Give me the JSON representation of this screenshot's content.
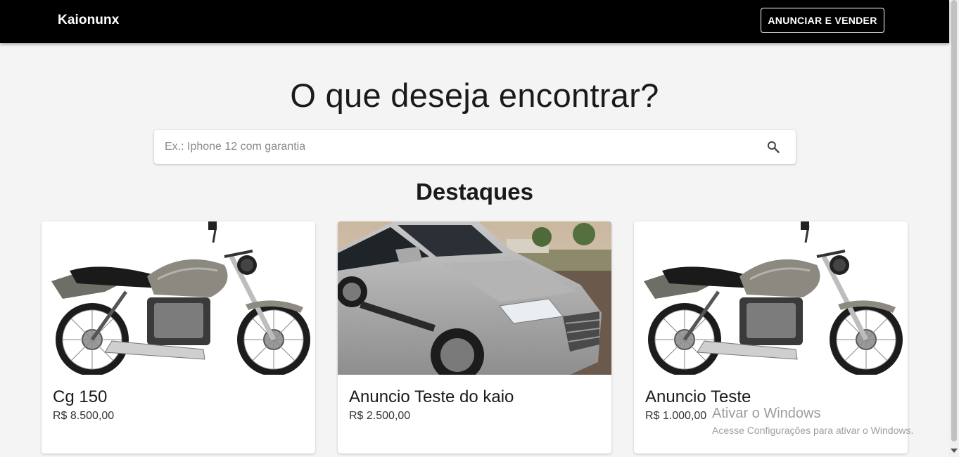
{
  "header": {
    "brand": "Kaionunx",
    "cta_label": "ANUNCIAR E VENDER"
  },
  "hero": {
    "title": "O que deseja encontrar?"
  },
  "search": {
    "placeholder": "Ex.: Iphone 12 com garantia",
    "value": "",
    "icon": "search-icon"
  },
  "featured": {
    "title": "Destaques",
    "items": [
      {
        "title": "Cg 150",
        "price": "R$ 8.500,00",
        "image": "motorcycle"
      },
      {
        "title": "Anuncio Teste do kaio",
        "price": "R$ 2.500,00",
        "image": "suv-car"
      },
      {
        "title": "Anuncio Teste",
        "price": "R$ 1.000,00",
        "image": "motorcycle"
      }
    ]
  },
  "watermark": {
    "title": "Ativar o Windows",
    "subtitle": "Acesse Configurações para ativar o Windows."
  },
  "colors": {
    "appbar": "#000000",
    "page_background": "#f4f4f4",
    "card_background": "#ffffff"
  }
}
